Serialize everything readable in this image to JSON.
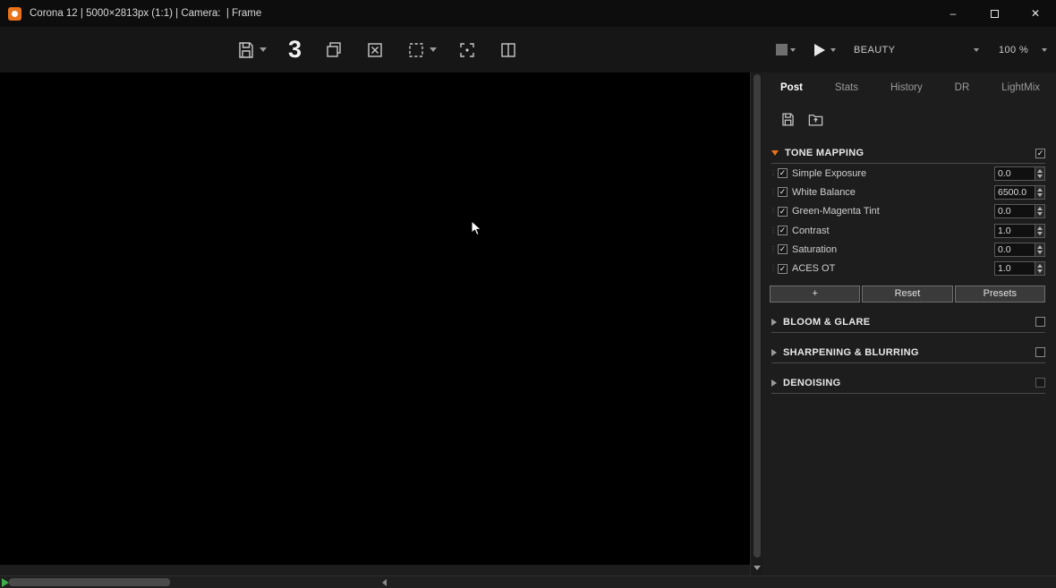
{
  "window": {
    "title": "Corona 12 | 5000×2813px (1:1) | Camera:  | Frame"
  },
  "icons": {
    "check": "✓",
    "minimize": "–",
    "close": "✕",
    "grip": "⋮"
  },
  "toolbar": {
    "render_number": "3",
    "render_pass": "BEAUTY",
    "zoom": "100 %",
    "left_icons": [
      "save-image",
      "render-slot-number",
      "duplicate",
      "clear-image",
      "region-render",
      "fit-to-view",
      "split-compare"
    ],
    "right_icons": [
      "stop-render",
      "start-render",
      "render-element-select",
      "zoom-select"
    ]
  },
  "panel": {
    "tabs": [
      {
        "label": "Post",
        "active": true
      },
      {
        "label": "Stats",
        "active": false
      },
      {
        "label": "History",
        "active": false
      },
      {
        "label": "DR",
        "active": false
      },
      {
        "label": "LightMix",
        "active": false
      }
    ],
    "icon_names": [
      "save-config",
      "load-config"
    ],
    "tone_mapping": {
      "title": "TONE MAPPING",
      "enabled": true,
      "rows": [
        {
          "label": "Simple Exposure",
          "value": "0.0",
          "checked": true
        },
        {
          "label": "White Balance",
          "value": "6500.0",
          "checked": true
        },
        {
          "label": "Green-Magenta Tint",
          "value": "0.0",
          "checked": true
        },
        {
          "label": "Contrast",
          "value": "1.0",
          "checked": true
        },
        {
          "label": "Saturation",
          "value": "0.0",
          "checked": true
        },
        {
          "label": "ACES OT",
          "value": "1.0",
          "checked": true
        }
      ],
      "buttons": [
        "+",
        "Reset",
        "Presets"
      ]
    },
    "sections": [
      {
        "title": "BLOOM & GLARE",
        "enabled": false
      },
      {
        "title": "SHARPENING & BLURRING",
        "enabled": false
      },
      {
        "title": "DENOISING",
        "enabled": false
      }
    ]
  },
  "colors": {
    "accent_orange": "#e8731a",
    "canvas": "#000000",
    "panel_bg": "#1d1d1d",
    "green_arrow": "#3fae49"
  }
}
